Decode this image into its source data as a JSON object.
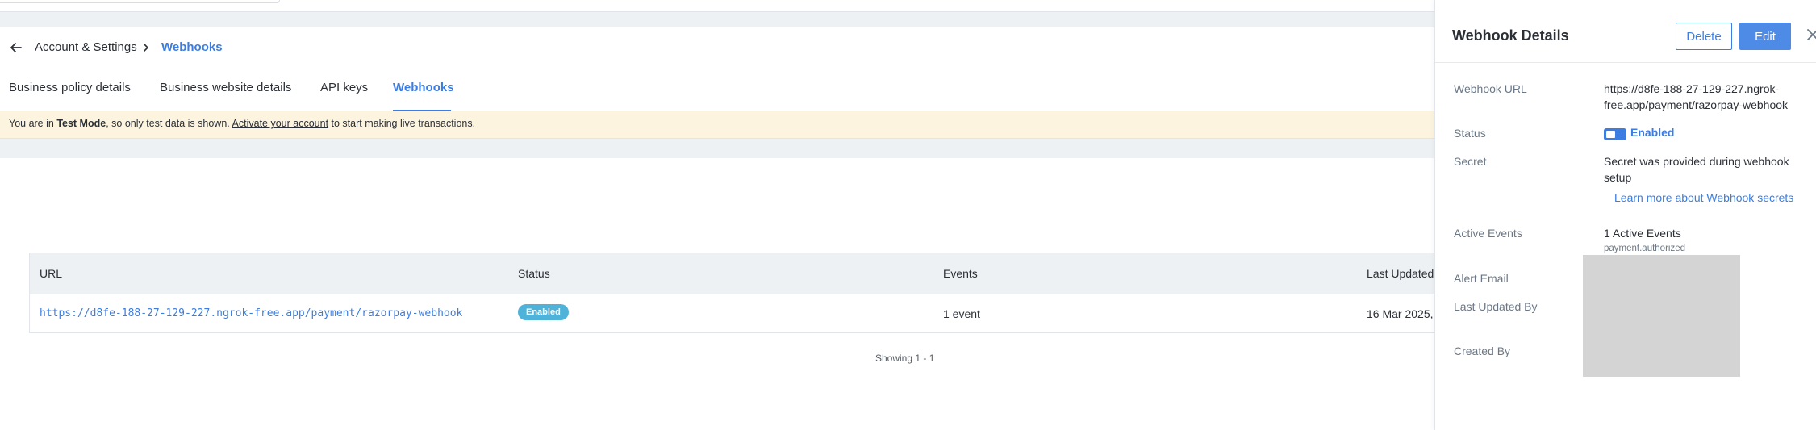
{
  "breadcrumb": {
    "parent": "Account & Settings",
    "current": "Webhooks"
  },
  "tabs": [
    {
      "label": "Business policy details"
    },
    {
      "label": "Business website details"
    },
    {
      "label": "API keys"
    },
    {
      "label": "Webhooks"
    }
  ],
  "banner": {
    "prefix": "You are in ",
    "mode": "Test Mode",
    "middle": ", so only test data is shown. ",
    "link": "Activate your account",
    "suffix": " to start making live transactions."
  },
  "table": {
    "headers": [
      "URL",
      "Status",
      "Events",
      "Last Updated"
    ],
    "row": {
      "url": "https://d8fe-188-27-129-227.ngrok-free.app/payment/razorpay-webhook",
      "status": "Enabled",
      "events": "1 event",
      "last_updated": "16 Mar 2025,"
    },
    "showing": "Showing 1 - 1"
  },
  "panel": {
    "title": "Webhook Details",
    "delete_label": "Delete",
    "edit_label": "Edit",
    "webhook_url_label": "Webhook URL",
    "webhook_url_line1": "https://d8fe-188-27-129-227.ngrok-",
    "webhook_url_line2": "free.app/payment/razorpay-webhook",
    "status_label": "Status",
    "status_value": "Enabled",
    "secret_label": "Secret",
    "secret_line1": "Secret was provided during webhook",
    "secret_line2": "setup",
    "learn_more": "Learn more about Webhook secrets",
    "active_events_label": "Active Events",
    "active_events_value": "1 Active Events",
    "active_events_sub": "payment.authorized",
    "alert_email_label": "Alert Email",
    "last_updated_by_label": "Last Updated By",
    "created_by_label": "Created By"
  },
  "colors": {
    "accent": "#3b7de0",
    "badge": "#4fb3d9",
    "banner_bg": "#fcf4df",
    "header_bg": "#eef1f4"
  },
  "icons": {
    "back": "arrow-left-icon",
    "separator": "chevron-right-icon",
    "close": "close-icon",
    "toggle": "toggle-icon"
  }
}
